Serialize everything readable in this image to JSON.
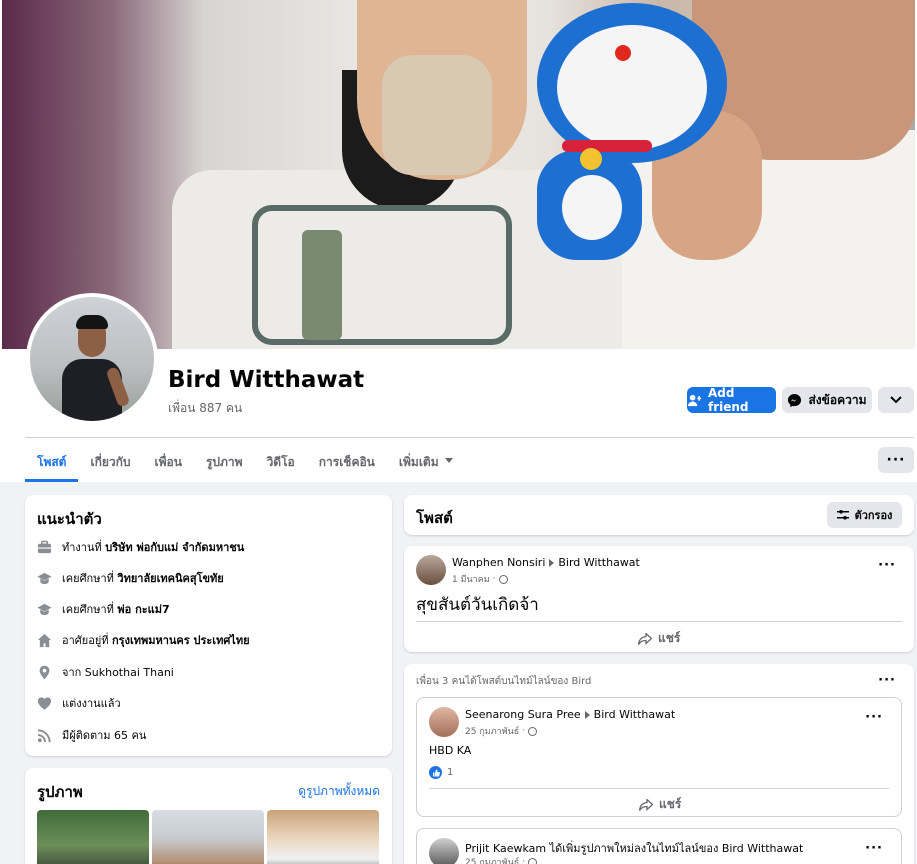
{
  "profile": {
    "name": "Bird Witthawat",
    "friends_count": "เพื่อน 887 คน"
  },
  "actions": {
    "add_friend": "Add friend",
    "message": "ส่งข้อความ"
  },
  "tabs": [
    {
      "label": "โพสต์"
    },
    {
      "label": "เกี่ยวกับ"
    },
    {
      "label": "เพื่อน"
    },
    {
      "label": "รูปภาพ"
    },
    {
      "label": "วิดีโอ"
    },
    {
      "label": "การเช็คอิน"
    },
    {
      "label": "เพิ่มเติม"
    }
  ],
  "intro": {
    "title": "แนะนำตัว",
    "rows": [
      {
        "prefix": "ทำงานที่ ",
        "bold": "บริษัท พ่อกับแม่ จำกัดมหาชน",
        "icon": "briefcase-icon"
      },
      {
        "prefix": "เคยศึกษาที่ ",
        "bold": "วิทยาลัยเทคนิคสุโขทัย",
        "icon": "graduation-cap-icon"
      },
      {
        "prefix": "เคยศึกษาที่ ",
        "bold": "พ่อ กะแม่7",
        "icon": "graduation-cap-icon"
      },
      {
        "prefix": "อาศัยอยู่ที่ ",
        "bold": "กรุงเทพมหานคร ประเทศไทย",
        "icon": "home-icon"
      },
      {
        "prefix": "จาก ",
        "bold": "Sukhothai Thani",
        "icon": "location-pin-icon"
      },
      {
        "prefix": "แต่งงานแล้ว",
        "bold": "",
        "icon": "heart-icon"
      },
      {
        "prefix": "มีผู้ติดตาม 65 คน",
        "bold": "",
        "icon": "rss-icon"
      }
    ]
  },
  "photos": {
    "title": "รูปภาพ",
    "see_all": "ดูรูปภาพทั้งหมด"
  },
  "posts_header": {
    "title": "โพสต์",
    "filter": "ตัวกรอง"
  },
  "post1": {
    "author": "Wanphen Nonsiri",
    "target": "Bird Witthawat",
    "date": "1 มีนาคม",
    "text": "สุขสันต์วันเกิดจ้า",
    "share": "แชร์"
  },
  "post2": {
    "summary": "เพื่อน 3 คนได้โพสต์บนไทม์ไลน์ของ Bird",
    "inner": {
      "author": "Seenarong Sura Pree",
      "target": "Bird Witthawat",
      "date": "25 กุมภาพันธ์",
      "text": "HBD KA",
      "likes": "1",
      "share": "แชร์"
    },
    "inner2": {
      "author": "Prijit Kaewkam",
      "action": " ได้เพิ่มรูปภาพใหม่ลงในไทม์ไลน์ของ ",
      "target": "Bird Witthawat",
      "date": "25 กุมภาพันธ์"
    }
  },
  "colors": {
    "accent": "#1b74e4",
    "background": "#f0f2f5",
    "secondary_text": "#65676b"
  }
}
